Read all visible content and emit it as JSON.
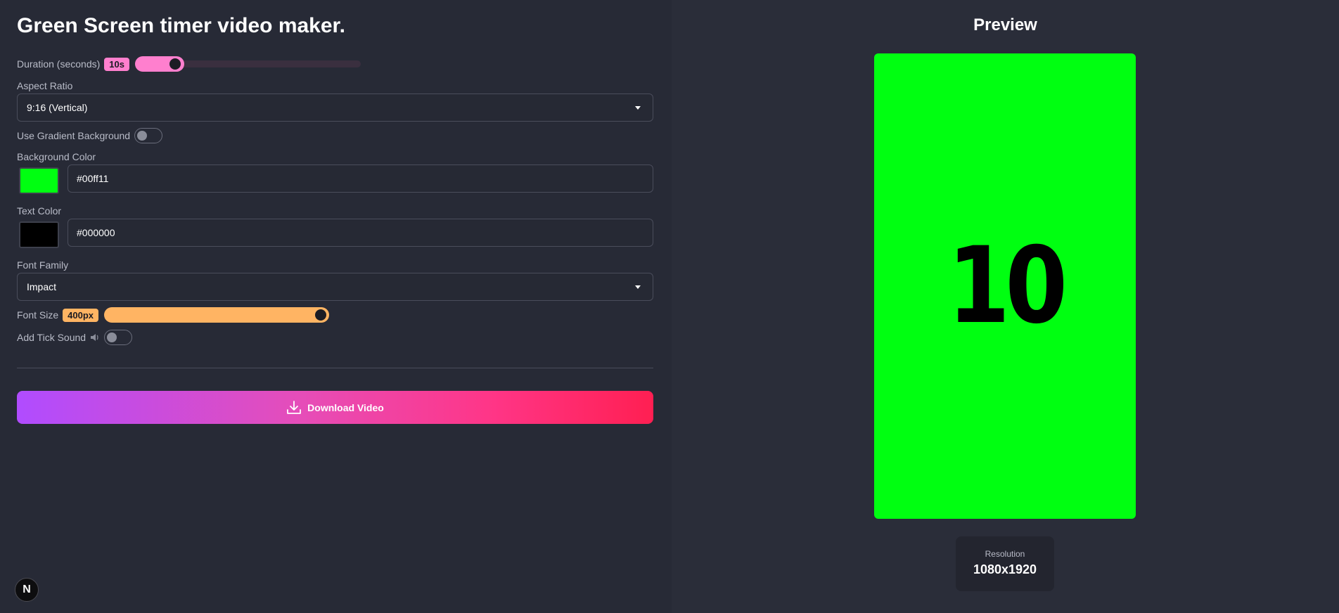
{
  "header": {
    "title": "Green Screen timer video maker."
  },
  "duration": {
    "label": "Duration (seconds)",
    "badge": "10s",
    "value_fraction": 0.2,
    "fill_color": "#ff7fce"
  },
  "aspect_ratio": {
    "label": "Aspect Ratio",
    "selected": "9:16 (Vertical)"
  },
  "gradient_bg": {
    "label": "Use Gradient Background",
    "enabled": false
  },
  "background_color": {
    "label": "Background Color",
    "value": "#00ff11",
    "display_value": "#00ff11"
  },
  "text_color": {
    "label": "Text Color",
    "value": "#000000",
    "display_value": "#000000"
  },
  "font_family": {
    "label": "Font Family",
    "selected": "Impact"
  },
  "font_size": {
    "label": "Font Size",
    "badge": "400px",
    "value_fraction": 1.0,
    "fill_color": "#ffb463"
  },
  "tick_sound": {
    "label": "Add Tick Sound",
    "icon": "speaker-icon",
    "enabled": false
  },
  "download": {
    "label": "Download Video",
    "icon": "download-icon"
  },
  "preview": {
    "title": "Preview",
    "count": "10",
    "resolution_label": "Resolution",
    "resolution_value": "1080x1920"
  },
  "framework_badge": {
    "label": "N"
  }
}
